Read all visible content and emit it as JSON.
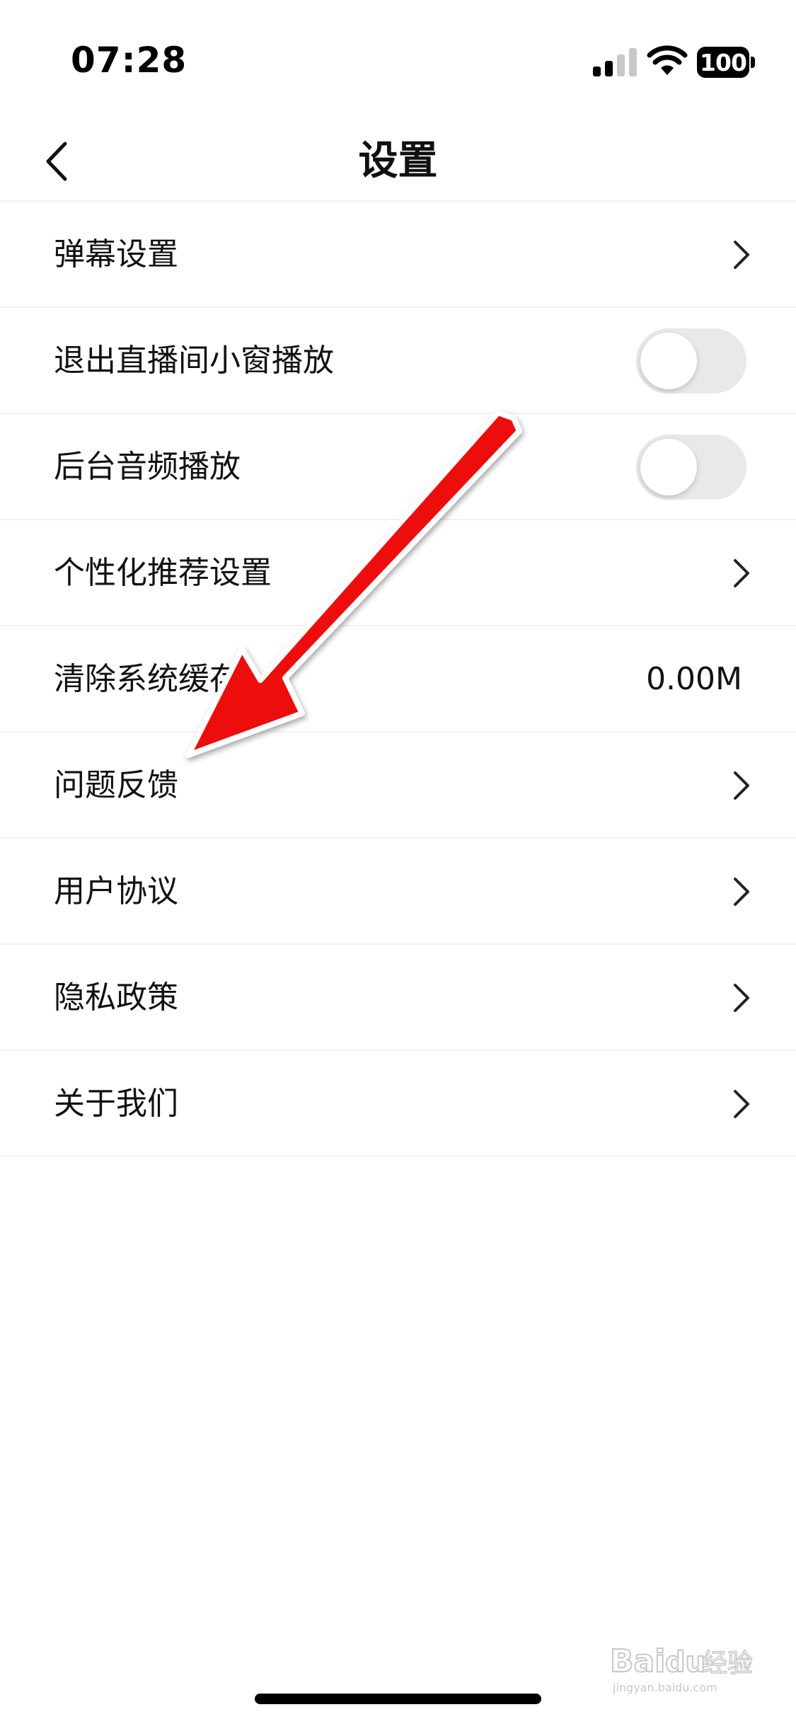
{
  "status_bar": {
    "time": "07:28",
    "battery": "100",
    "icons": [
      "cellular-signal-icon",
      "wifi-icon",
      "battery-icon"
    ]
  },
  "nav": {
    "title": "设置",
    "back_icon": "chevron-left-icon"
  },
  "settings": {
    "items": [
      {
        "label": "弹幕设置",
        "control": "chevron"
      },
      {
        "label": "退出直播间小窗播放",
        "control": "toggle",
        "toggle_on": false
      },
      {
        "label": "后台音频播放",
        "control": "toggle",
        "toggle_on": false
      },
      {
        "label": "个性化推荐设置",
        "control": "chevron"
      },
      {
        "label": "清除系统缓存",
        "control": "value",
        "value": "0.00M"
      },
      {
        "label": "问题反馈",
        "control": "chevron"
      },
      {
        "label": "用户协议",
        "control": "chevron"
      },
      {
        "label": "隐私政策",
        "control": "chevron"
      },
      {
        "label": "关于我们",
        "control": "chevron"
      }
    ]
  },
  "annotation": {
    "arrow_color": "#ee1111",
    "target_item": "问题反馈"
  },
  "watermark": {
    "brand": "Bai",
    "suffix": "du",
    "tagline": "经验",
    "url": "jingyan.baidu.com"
  },
  "colors": {
    "background": "#ffffff",
    "text": "#111111",
    "divider": "#f2f2f2",
    "toggle_off": "#e9e9ea"
  }
}
